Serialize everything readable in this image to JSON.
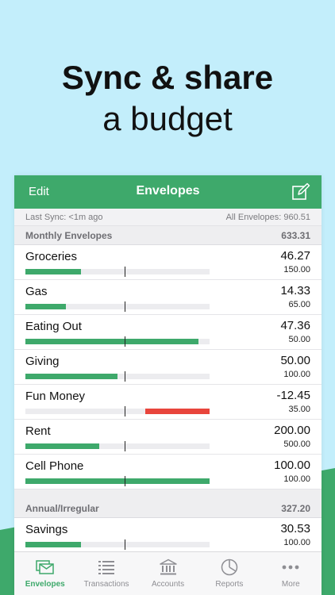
{
  "headline": {
    "line1": "Sync & share",
    "line2": "a budget"
  },
  "colors": {
    "accent": "#3ea96b",
    "over_budget": "#e8453c",
    "bg": "#c3eefb"
  },
  "navbar": {
    "edit_label": "Edit",
    "title": "Envelopes",
    "compose_icon": "compose-icon"
  },
  "sync": {
    "last_sync": "Last Sync: <1m ago",
    "all_envelopes": "All Envelopes: 960.51"
  },
  "sections": [
    {
      "name": "Monthly Envelopes",
      "total": "633.31",
      "envelopes": [
        {
          "name": "Groceries",
          "amount": "46.27",
          "budget": "150.00",
          "fill": 0.3,
          "over": false
        },
        {
          "name": "Gas",
          "amount": "14.33",
          "budget": "65.00",
          "fill": 0.22,
          "over": false
        },
        {
          "name": "Eating Out",
          "amount": "47.36",
          "budget": "50.00",
          "fill": 0.94,
          "over": false
        },
        {
          "name": "Giving",
          "amount": "50.00",
          "budget": "100.00",
          "fill": 0.5,
          "over": false
        },
        {
          "name": "Fun Money",
          "amount": "-12.45",
          "budget": "35.00",
          "fill": 0.35,
          "over": true
        },
        {
          "name": "Rent",
          "amount": "200.00",
          "budget": "500.00",
          "fill": 0.4,
          "over": false
        },
        {
          "name": "Cell Phone",
          "amount": "100.00",
          "budget": "100.00",
          "fill": 1.0,
          "over": false
        }
      ]
    },
    {
      "name": "Annual/Irregular",
      "total": "327.20",
      "envelopes": [
        {
          "name": "Savings",
          "amount": "30.53",
          "budget": "100.00",
          "fill": 0.3,
          "over": false
        }
      ]
    }
  ],
  "tabs": [
    {
      "label": "Envelopes",
      "icon": "envelopes-icon",
      "active": true
    },
    {
      "label": "Transactions",
      "icon": "list-icon",
      "active": false
    },
    {
      "label": "Accounts",
      "icon": "bank-icon",
      "active": false
    },
    {
      "label": "Reports",
      "icon": "pie-chart-icon",
      "active": false
    },
    {
      "label": "More",
      "icon": "more-dots-icon",
      "active": false
    }
  ]
}
